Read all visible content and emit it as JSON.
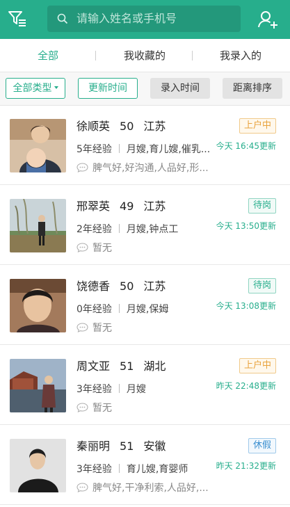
{
  "search": {
    "placeholder": "请输入姓名或手机号"
  },
  "icons": {
    "filter": "filter-list-icon",
    "search": "search-icon",
    "add_user": "add-user-icon",
    "comment": "comment-bubble-icon"
  },
  "colors": {
    "brand": "#27ae8c",
    "brand_dark": "#23987b",
    "status_orange": "#e8a23c",
    "status_green": "#27ae8c",
    "status_blue": "#3a8fd0"
  },
  "tabs": [
    {
      "label": "全部",
      "active": true
    },
    {
      "label": "我收藏的",
      "active": false
    },
    {
      "label": "我录入的",
      "active": false
    }
  ],
  "filters": {
    "type": "全部类型",
    "update_time": "更新时间",
    "entry_time": "录入时间",
    "distance": "距离排序"
  },
  "workers": [
    {
      "name": "徐顺英",
      "age": "50",
      "province": "江苏",
      "experience": "5年经验",
      "skills": "月嫂,育儿嫂,催乳...",
      "comment": "脾气好,好沟通,人品好,形...",
      "status": "上户中",
      "updated": "今天 16:45更新"
    },
    {
      "name": "邢翠英",
      "age": "49",
      "province": "江苏",
      "experience": "2年经验",
      "skills": "月嫂,钟点工",
      "comment": "暂无",
      "status": "待岗",
      "updated": "今天 13:50更新"
    },
    {
      "name": "饶德香",
      "age": "50",
      "province": "江苏",
      "experience": "0年经验",
      "skills": "月嫂,保姆",
      "comment": "暂无",
      "status": "待岗",
      "updated": "今天 13:08更新"
    },
    {
      "name": "周文亚",
      "age": "51",
      "province": "湖北",
      "experience": "3年经验",
      "skills": "月嫂",
      "comment": "暂无",
      "status": "上户中",
      "updated": "昨天 22:48更新"
    },
    {
      "name": "秦丽明",
      "age": "51",
      "province": "安徽",
      "experience": "3年经验",
      "skills": "育儿嫂,育婴师",
      "comment": "脾气好,干净利索,人品好,...",
      "status": "休假",
      "updated": "昨天 21:32更新"
    }
  ]
}
